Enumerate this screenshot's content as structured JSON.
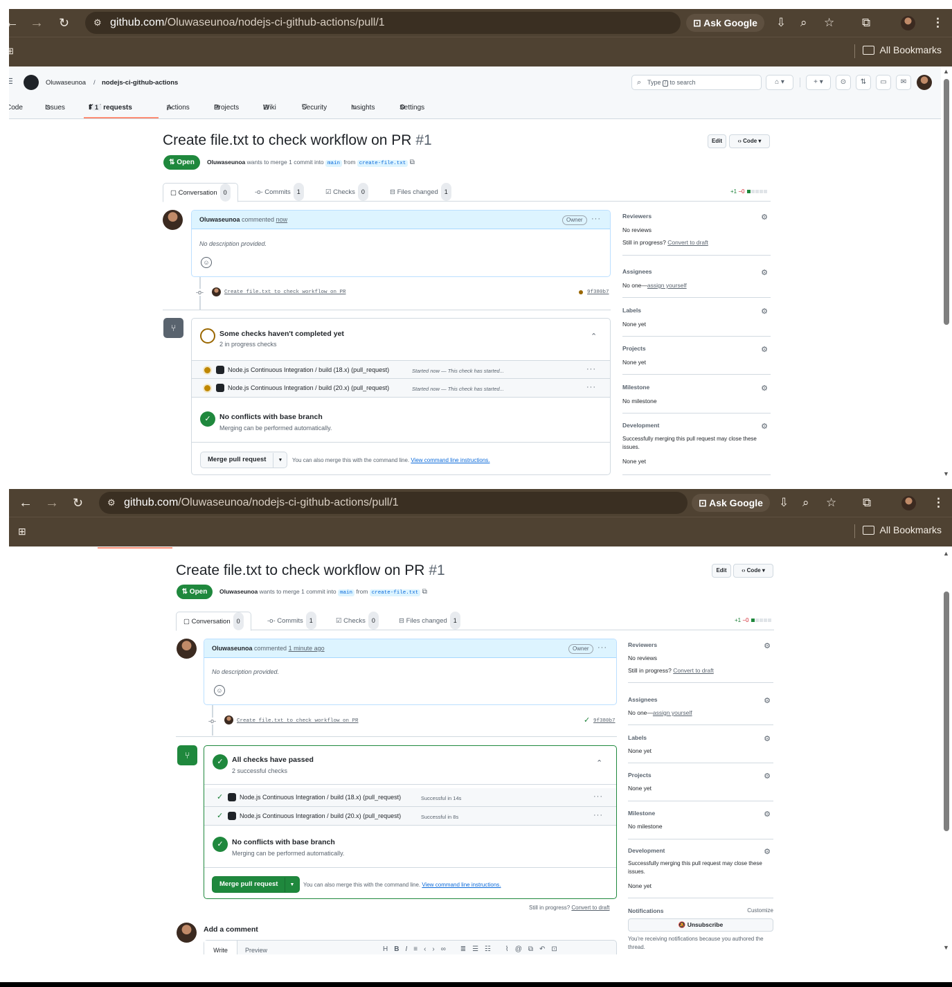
{
  "browser": {
    "url_host": "github.com",
    "url_path": "/Oluwaseunoa/nodejs-ci-github-actions/pull/1",
    "ask_google": "Ask Google",
    "all_bookmarks": "All Bookmarks"
  },
  "header": {
    "owner": "Oluwaseunoa",
    "separator": "/",
    "repo": "nodejs-ci-github-actions",
    "search_prefix": "Type",
    "search_key": "/",
    "search_suffix": "to search"
  },
  "repo_nav": {
    "code": "Code",
    "issues": "Issues",
    "pull_requests": "Pull requests",
    "pull_requests_count": "1",
    "actions": "Actions",
    "projects": "Projects",
    "wiki": "Wiki",
    "security": "Security",
    "insights": "Insights",
    "settings": "Settings"
  },
  "pr": {
    "title": "Create file.txt to check workflow on PR",
    "number": "#1",
    "edit": "Edit",
    "code": "Code",
    "state": "Open",
    "author": "Oluwaseunoa",
    "merge_text": "wants to merge 1 commit into",
    "base": "main",
    "from": "from",
    "head": "create-file.txt"
  },
  "tabs": {
    "conversation": "Conversation",
    "conversation_count": "0",
    "commits": "Commits",
    "commits_count": "1",
    "checks": "Checks",
    "checks_count": "0",
    "files": "Files changed",
    "files_count": "1",
    "add": "+1",
    "del": "−0"
  },
  "comment": {
    "author": "Oluwaseunoa",
    "verb": "commented",
    "time_1": "now",
    "time_2": "1 minute ago",
    "owner_badge": "Owner",
    "body": "No description provided."
  },
  "commit": {
    "message": "Create file.txt to check workflow on PR",
    "sha": "9f380b7"
  },
  "checks_pending": {
    "title": "Some checks haven't completed yet",
    "subtitle": "2 in progress checks",
    "rows": [
      {
        "name": "Node.js Continuous Integration / build (18.x) (pull_request)",
        "status": "Started now — This check has started..."
      },
      {
        "name": "Node.js Continuous Integration / build (20.x) (pull_request)",
        "status": "Started now — This check has started..."
      }
    ]
  },
  "checks_passed": {
    "title": "All checks have passed",
    "subtitle": "2 successful checks",
    "rows": [
      {
        "name": "Node.js Continuous Integration / build (18.x) (pull_request)",
        "status": "Successful in 14s"
      },
      {
        "name": "Node.js Continuous Integration / build (20.x) (pull_request)",
        "status": "Successful in 8s"
      }
    ]
  },
  "conflicts": {
    "title": "No conflicts with base branch",
    "subtitle": "Merging can be performed automatically."
  },
  "merge": {
    "button": "Merge pull request",
    "hint": "You can also merge this with the command line.",
    "hint_link": "View command line instructions."
  },
  "sidebar": {
    "reviewers": "Reviewers",
    "no_reviews": "No reviews",
    "in_progress": "Still in progress?",
    "convert": "Convert to draft",
    "assignees": "Assignees",
    "no_one": "No one—",
    "assign_yourself": "assign yourself",
    "labels": "Labels",
    "none_yet": "None yet",
    "projects": "Projects",
    "milestone": "Milestone",
    "no_milestone": "No milestone",
    "development": "Development",
    "dev_text_1": "Successfully merging this pull request may close these",
    "dev_text_2": "issues.",
    "notifications": "Notifications",
    "customize": "Customize",
    "unsubscribe": "Unsubscribe",
    "notif_text_1": "You're receiving notifications because you authored the",
    "notif_text_2": "thread."
  },
  "below_merge": {
    "still": "Still in progress?",
    "convert": "Convert to draft"
  },
  "add_comment": {
    "title": "Add a comment",
    "write": "Write",
    "preview": "Preview"
  },
  "colors": {
    "green": "#1f883d",
    "pending": "#9a6700",
    "chrome": "#4f4232",
    "link": "#0969da"
  }
}
